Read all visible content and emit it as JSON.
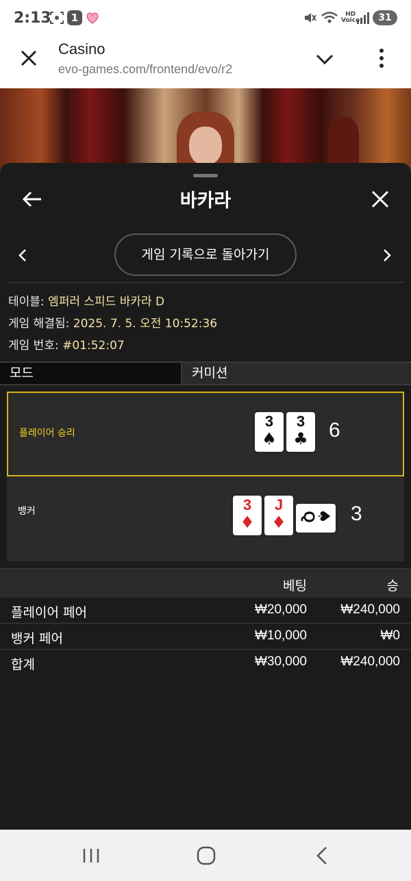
{
  "status_bar": {
    "time": "2:13",
    "notification_count": "1",
    "network_label_top": "HD",
    "network_label_bottom": "Voice",
    "battery": "31"
  },
  "browser": {
    "title": "Casino",
    "url": "evo-games.com/frontend/evo/r2"
  },
  "header": {
    "title": "바카라"
  },
  "back_to_history_label": "게임 기록으로 돌아가기",
  "game_info": {
    "table_label": "테이블:",
    "table_value": "엠퍼러 스피드 바카라 D",
    "resolved_label": "게임 해결됨:",
    "resolved_value": "2025. 7. 5. 오전 10:52:36",
    "number_label": "게임 번호:",
    "number_value": "#01:52:07"
  },
  "tabs": {
    "mode_label": "모드",
    "mode_value": "커미션"
  },
  "result": {
    "player": {
      "label": "플레이어 승리",
      "score": "6",
      "cards": [
        {
          "rank": "3",
          "suit": "♠",
          "color": "black"
        },
        {
          "rank": "3",
          "suit": "♣",
          "color": "black"
        }
      ]
    },
    "banker": {
      "label": "뱅커",
      "score": "3",
      "cards": [
        {
          "rank": "3",
          "suit": "♦",
          "color": "red"
        },
        {
          "rank": "J",
          "suit": "♦",
          "color": "red"
        },
        {
          "rank": "Q",
          "suit": "♠",
          "color": "black",
          "sideways": true
        }
      ]
    }
  },
  "bets": {
    "headers": {
      "bet": "베팅",
      "win": "승"
    },
    "rows": [
      {
        "label": "플레이어 페어",
        "bet": "₩20,000",
        "win": "₩240,000"
      },
      {
        "label": "뱅커 페어",
        "bet": "₩10,000",
        "win": "₩0"
      }
    ],
    "total": {
      "label": "합계",
      "bet": "₩30,000",
      "win": "₩240,000"
    }
  },
  "colors": {
    "sheet_bg": "#1b1b1b",
    "win_highlight": "#d6b31d",
    "info_value": "#f3e4a6"
  }
}
